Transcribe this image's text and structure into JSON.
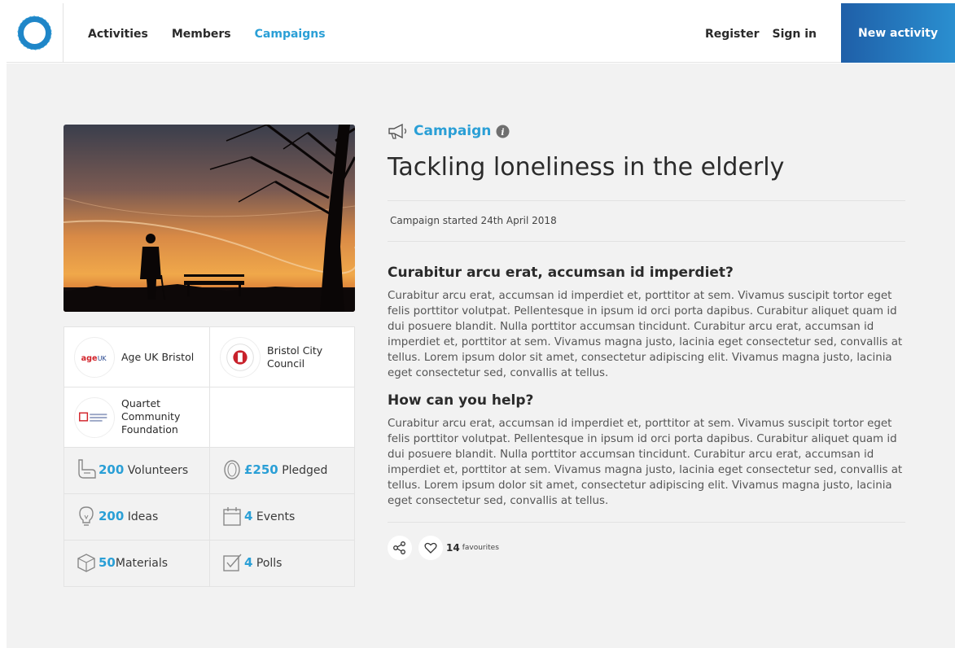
{
  "nav": {
    "items": [
      {
        "label": "Activities",
        "active": false
      },
      {
        "label": "Members",
        "active": false
      },
      {
        "label": "Campaigns",
        "active": true
      }
    ]
  },
  "auth": {
    "register": "Register",
    "sign_in": "Sign in"
  },
  "new_activity_label": "New activity",
  "campaign": {
    "tag": "Campaign",
    "title": "Tackling loneliness in the elderly",
    "started": "Campaign started 24th April 2018",
    "section1_heading": "Curabitur arcu erat, accumsan id imperdiet?",
    "section1_body": "Curabitur arcu erat, accumsan id imperdiet et, porttitor at sem. Vivamus suscipit tortor eget felis porttitor volutpat. Pellentesque in ipsum id orci porta dapibus. Curabitur aliquet quam id dui posuere blandit. Nulla porttitor accumsan tincidunt. Curabitur arcu erat, accumsan id imperdiet et, porttitor at sem. Vivamus magna justo, lacinia eget consectetur sed, convallis at tellus. Lorem ipsum dolor sit amet, consectetur adipiscing elit. Vivamus magna justo, lacinia eget consectetur sed, convallis at tellus.",
    "section2_heading": "How can you help?",
    "section2_body": "Curabitur arcu erat, accumsan id imperdiet et, porttitor at sem. Vivamus suscipit tortor eget felis porttitor volutpat. Pellentesque in ipsum id orci porta dapibus. Curabitur aliquet quam id dui posuere blandit. Nulla porttitor accumsan tincidunt. Curabitur arcu erat, accumsan id imperdiet et, porttitor at sem. Vivamus magna justo, lacinia eget consectetur sed, convallis at tellus. Lorem ipsum dolor sit amet, consectetur adipiscing elit. Vivamus magna justo, lacinia eget consectetur sed, convallis at tellus.",
    "favourites_count": "14",
    "favourites_label": "favourites"
  },
  "orgs": [
    {
      "name": "Age UK Bristol",
      "logo_text": "ageUK",
      "logo_small": "Bristol"
    },
    {
      "name": "Bristol City Council",
      "logo_text": "BRISTOL CITY COUNCIL"
    },
    {
      "name": "Quartet Community Foundation",
      "logo_text": "Community Foundation"
    }
  ],
  "stats": {
    "volunteers": {
      "value": "200",
      "label": "Volunteers"
    },
    "pledged": {
      "value": "£250",
      "label": "Pledged"
    },
    "ideas": {
      "value": "200",
      "label": "Ideas"
    },
    "events": {
      "value": "4",
      "label": "Events"
    },
    "materials": {
      "value": "50",
      "label": "Materials"
    },
    "polls": {
      "value": "4",
      "label": "Polls"
    }
  },
  "colors": {
    "accent": "#2a9fd6",
    "button_start": "#1f5fa8",
    "button_end": "#2a8fd0"
  }
}
